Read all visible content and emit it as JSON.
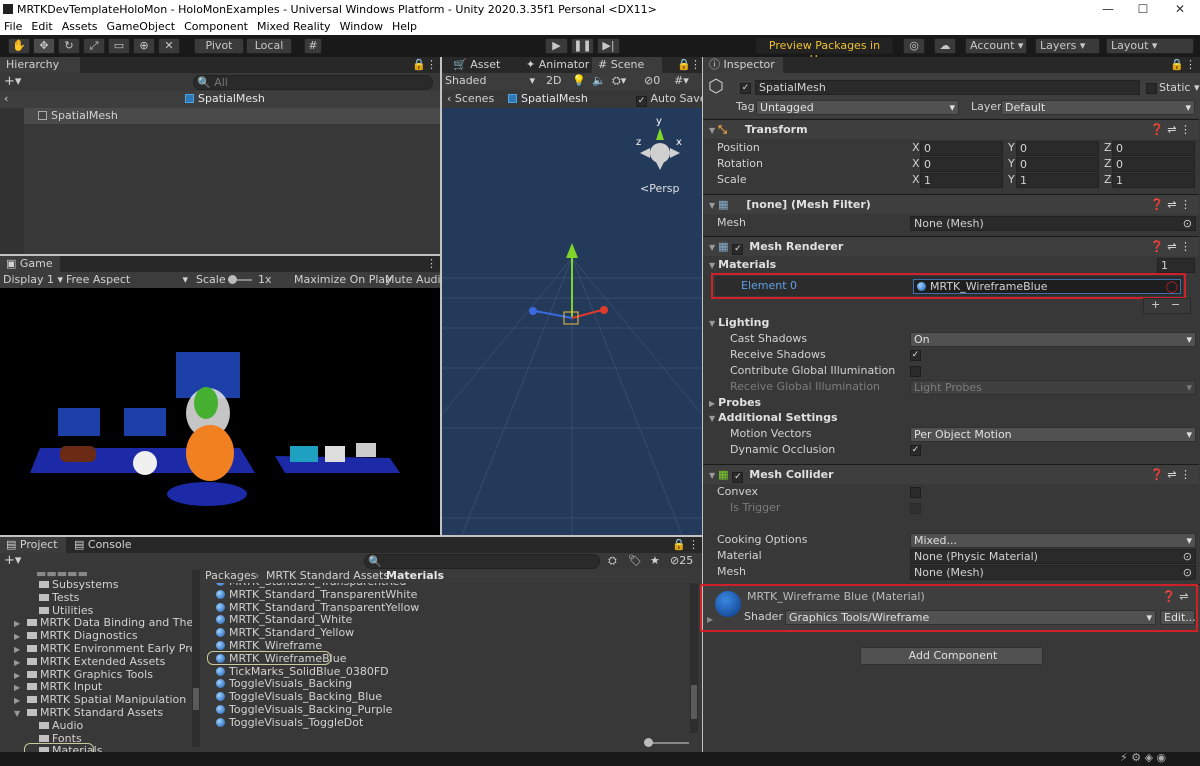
{
  "window": {
    "title": "MRTKDevTemplateHoloMon - HoloMonExamples - Universal Windows Platform - Unity 2020.3.35f1 Personal <DX11>",
    "minimize": "—",
    "maximize": "☐",
    "close": "✕"
  },
  "menu": [
    "File",
    "Edit",
    "Assets",
    "GameObject",
    "Component",
    "Mixed Reality",
    "Window",
    "Help"
  ],
  "toolbar": {
    "pivot": "Pivot",
    "local": "Local",
    "preview_packages": "Preview Packages in Use ▾",
    "account": "Account",
    "layers": "Layers",
    "layout": "Layout"
  },
  "hierarchy": {
    "tab": "Hierarchy",
    "search_placeholder": "All",
    "scene": "SpatialMesh",
    "items": [
      "SpatialMesh"
    ]
  },
  "game": {
    "tab": "Game",
    "display": "Display 1",
    "aspect": "Free Aspect",
    "scale_label": "Scale",
    "scale_value": "1x",
    "maximize": "Maximize On Play",
    "mute": "Mute Audio"
  },
  "scene_view": {
    "tabs": [
      "Asset Store",
      "Animator",
      "Scene"
    ],
    "shading": "Shaded",
    "mode2d": "2D",
    "gizmo_count": "0",
    "breadcrumb_root": "Scenes",
    "breadcrumb_obj": "SpatialMesh",
    "auto_save": "Auto Save",
    "persp": "<Persp",
    "axis_y": "y",
    "axis_x": "x",
    "axis_z": "z"
  },
  "project": {
    "tabs": [
      "Project",
      "Console"
    ],
    "hidden_count": "25",
    "breadcrumb": [
      "Packages",
      "MRTK Standard Assets",
      "Materials"
    ],
    "tree": [
      {
        "label": "Subsystems",
        "indent": 2,
        "arrow": ""
      },
      {
        "label": "Tests",
        "indent": 2,
        "arrow": ""
      },
      {
        "label": "Utilities",
        "indent": 2,
        "arrow": ""
      },
      {
        "label": "MRTK Data Binding and Theming",
        "indent": 1,
        "arrow": "▶"
      },
      {
        "label": "MRTK Diagnostics",
        "indent": 1,
        "arrow": "▶"
      },
      {
        "label": "MRTK Environment Early Preview",
        "indent": 1,
        "arrow": "▶"
      },
      {
        "label": "MRTK Extended Assets",
        "indent": 1,
        "arrow": "▶"
      },
      {
        "label": "MRTK Graphics Tools",
        "indent": 1,
        "arrow": "▶"
      },
      {
        "label": "MRTK Input",
        "indent": 1,
        "arrow": "▶"
      },
      {
        "label": "MRTK Spatial Manipulation",
        "indent": 1,
        "arrow": "▶"
      },
      {
        "label": "MRTK Standard Assets",
        "indent": 1,
        "arrow": "▼"
      },
      {
        "label": "Audio",
        "indent": 2,
        "arrow": ""
      },
      {
        "label": "Fonts",
        "indent": 2,
        "arrow": ""
      },
      {
        "label": "Materials",
        "indent": 2,
        "arrow": ""
      }
    ],
    "files": [
      "MRTK_Standard_TransparentRed",
      "MRTK_Standard_TransparentWhite",
      "MRTK_Standard_TransparentYellow",
      "MRTK_Standard_White",
      "MRTK_Standard_Yellow",
      "MRTK_Wireframe",
      "MRTK_WireframeBlue",
      "TickMarks_SolidBlue_0380FD",
      "ToggleVisuals_Backing",
      "ToggleVisuals_Backing_Blue",
      "ToggleVisuals_Backing_Purple",
      "ToggleVisuals_ToggleDot"
    ]
  },
  "inspector": {
    "tab": "Inspector",
    "object_name": "SpatialMesh",
    "static": "Static",
    "tag_label": "Tag",
    "tag": "Untagged",
    "layer_label": "Layer",
    "layer": "Default",
    "transform": {
      "title": "Transform",
      "position": "Position",
      "rotation": "Rotation",
      "scale": "Scale",
      "pos": [
        "0",
        "0",
        "0"
      ],
      "rot": [
        "0",
        "0",
        "0"
      ],
      "scl": [
        "1",
        "1",
        "1"
      ],
      "axes": [
        "X",
        "Y",
        "Z"
      ]
    },
    "mesh_filter": {
      "title": "[none] (Mesh Filter)",
      "mesh_label": "Mesh",
      "mesh": "None (Mesh)"
    },
    "mesh_renderer": {
      "title": "Mesh Renderer",
      "materials": "Materials",
      "count": "1",
      "element_label": "Element 0",
      "element": "MRTK_WireframeBlue",
      "add": "+",
      "remove": "−",
      "lighting": "Lighting",
      "cast_shadows": "Cast Shadows",
      "cast_value": "On",
      "receive_shadows": "Receive Shadows",
      "contribute_gi": "Contribute Global Illumination",
      "receive_gi": "Receive Global Illumination",
      "receive_gi_value": "Light Probes",
      "probes": "Probes",
      "additional": "Additional Settings",
      "motion_vectors": "Motion Vectors",
      "motion_value": "Per Object Motion",
      "dynamic_occlusion": "Dynamic Occlusion"
    },
    "mesh_collider": {
      "title": "Mesh Collider",
      "convex": "Convex",
      "is_trigger": "Is Trigger",
      "cooking": "Cooking Options",
      "cooking_value": "Mixed...",
      "material_label": "Material",
      "material": "None (Physic Material)",
      "mesh_label": "Mesh",
      "mesh": "None (Mesh)"
    },
    "material": {
      "title": "MRTK_Wireframe Blue (Material)",
      "shader_label": "Shader",
      "shader": "Graphics Tools/Wireframe",
      "edit": "Edit..."
    },
    "add_component": "Add Component"
  },
  "colors": {
    "accent": "#d0202a",
    "highlight_outline": "#c8c89a"
  }
}
